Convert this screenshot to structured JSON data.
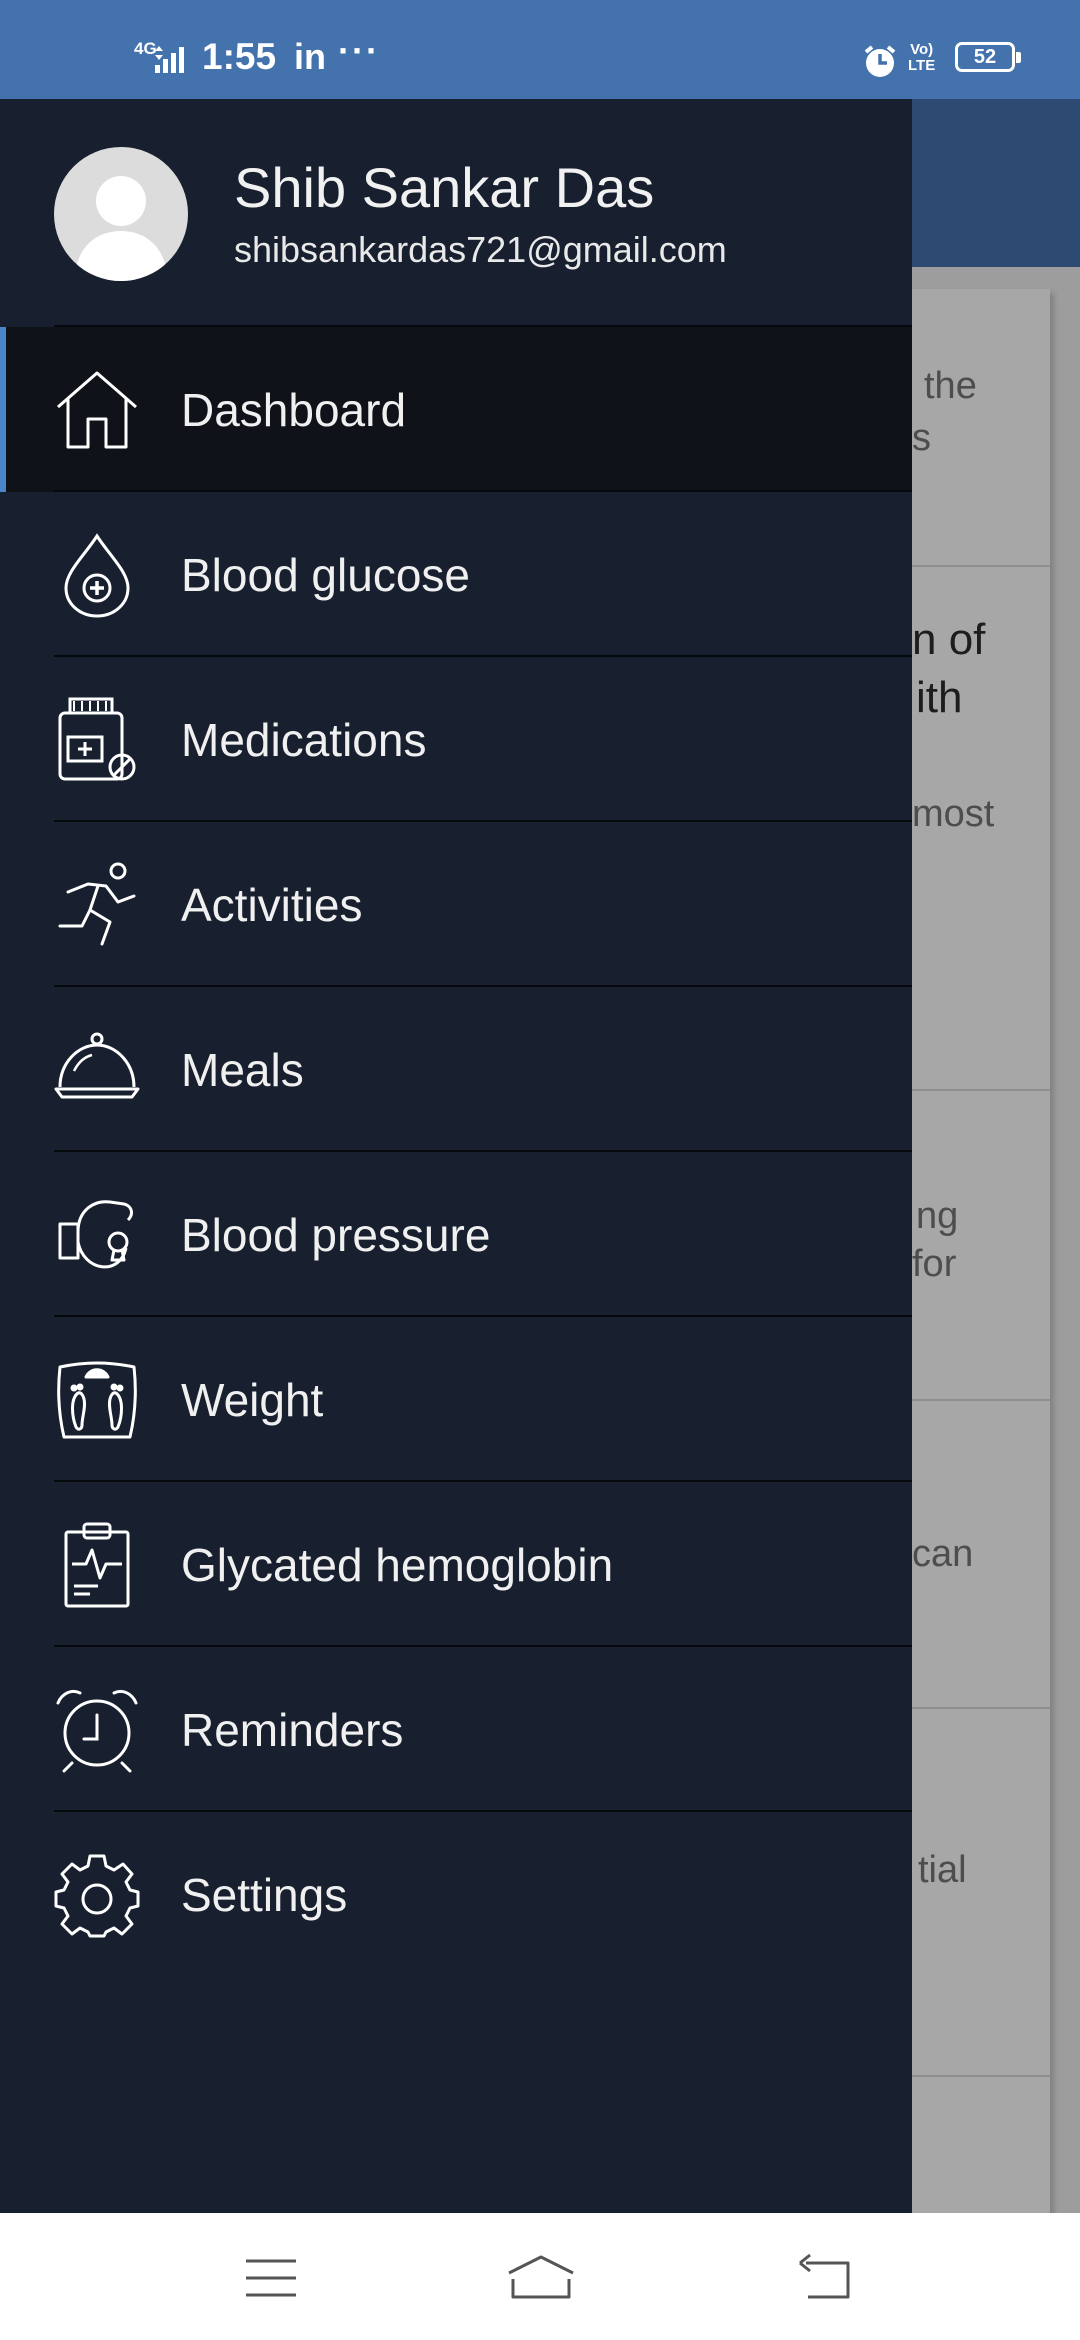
{
  "status_bar": {
    "network": "4G",
    "time": "1:55",
    "app_indicator": "in",
    "more": "···",
    "volte": "Vo)\nLTE",
    "battery": "52"
  },
  "background": {
    "snippets": [
      "the",
      "s",
      "n of",
      "ith",
      "most",
      "ng",
      "for",
      "can",
      "tial"
    ],
    "news_link": "news"
  },
  "drawer": {
    "user": {
      "name": "Shib Sankar Das",
      "email": "shibsankardas721@gmail.com"
    },
    "items": [
      {
        "label": "Dashboard",
        "icon": "home-icon"
      },
      {
        "label": "Blood glucose",
        "icon": "blood-drop-icon"
      },
      {
        "label": "Medications",
        "icon": "medicine-bottle-icon"
      },
      {
        "label": "Activities",
        "icon": "running-person-icon"
      },
      {
        "label": "Meals",
        "icon": "meal-cloche-icon"
      },
      {
        "label": "Blood pressure",
        "icon": "blood-pressure-icon"
      },
      {
        "label": "Weight",
        "icon": "weighing-scale-icon"
      },
      {
        "label": "Glycated hemoglobin",
        "icon": "clipboard-pulse-icon"
      },
      {
        "label": "Reminders",
        "icon": "alarm-clock-icon"
      },
      {
        "label": "Settings",
        "icon": "gear-icon"
      }
    ],
    "active_item": "Dashboard"
  },
  "nav_bar": {
    "buttons": [
      "menu-icon",
      "home-icon",
      "back-icon"
    ]
  },
  "colors": {
    "status_bar": "#4372ad",
    "drawer_bg": "#18202f",
    "active_bg": "#0f1319",
    "active_accent": "#4a86c8"
  }
}
